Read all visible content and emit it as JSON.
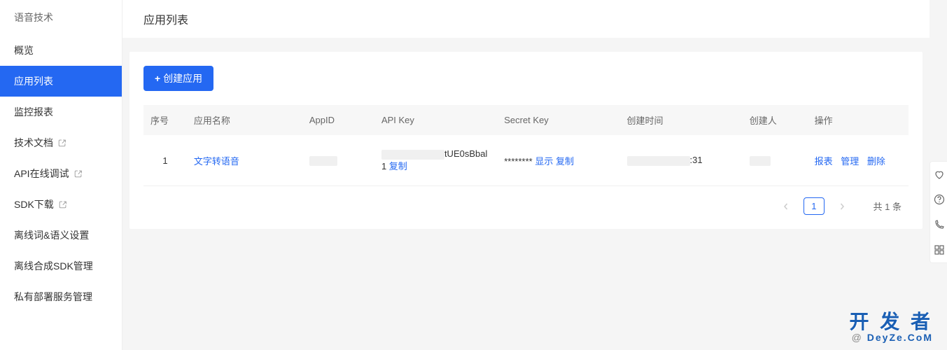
{
  "sidebar": {
    "header": "语音技术",
    "items": [
      {
        "label": "概览",
        "has_link": false
      },
      {
        "label": "应用列表",
        "has_link": false,
        "active": true
      },
      {
        "label": "监控报表",
        "has_link": false
      },
      {
        "label": "技术文档",
        "has_link": true
      },
      {
        "label": "API在线调试",
        "has_link": true
      },
      {
        "label": "SDK下载",
        "has_link": true
      },
      {
        "label": "离线词&语义设置",
        "has_link": false
      },
      {
        "label": "离线合成SDK管理",
        "has_link": false
      },
      {
        "label": "私有部署服务管理",
        "has_link": false
      }
    ]
  },
  "page": {
    "title": "应用列表",
    "create_button": "创建应用"
  },
  "table": {
    "headers": {
      "seq": "序号",
      "name": "应用名称",
      "appid": "AppID",
      "apikey": "API Key",
      "secret": "Secret Key",
      "time": "创建时间",
      "creator": "创建人",
      "action": "操作"
    },
    "rows": [
      {
        "seq": "1",
        "name": "文字转语音",
        "apikey_suffix": "tUE0sBbal1",
        "apikey_copy": "复制",
        "secret_masked": "********",
        "secret_show": "显示",
        "secret_copy": "复制",
        "time_suffix": ":31",
        "actions": {
          "report": "报表",
          "manage": "管理",
          "delete": "删除"
        }
      }
    ]
  },
  "pagination": {
    "current": "1",
    "total_text": "共 1 条"
  },
  "watermark": {
    "main": "开 发 者",
    "sub": "DeyZe.CoM"
  }
}
